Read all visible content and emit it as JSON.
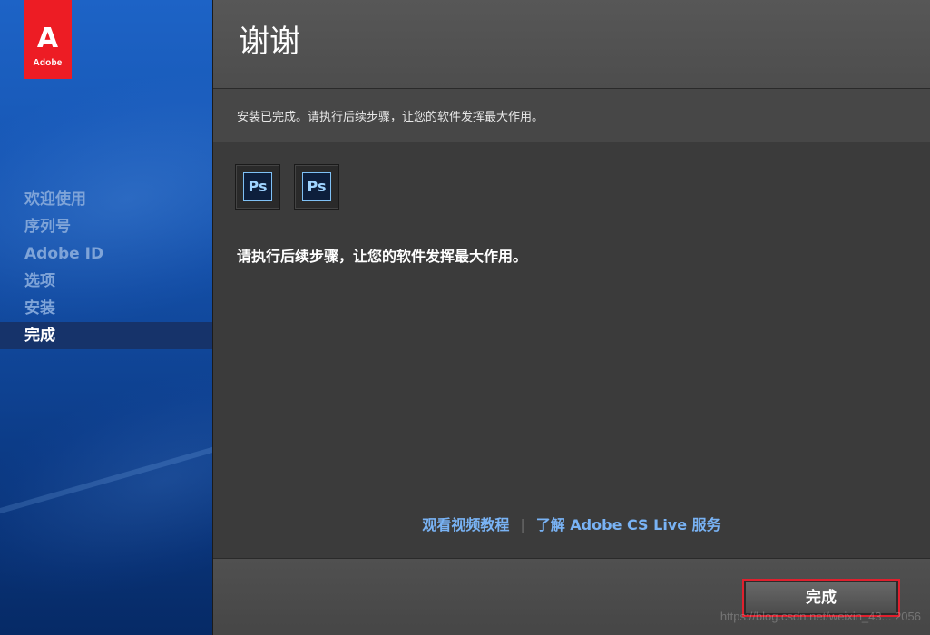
{
  "logo": {
    "letter": "A",
    "text": "Adobe"
  },
  "sidebar": {
    "steps": [
      {
        "label": "欢迎使用"
      },
      {
        "label": "序列号"
      },
      {
        "label": "Adobe ID"
      },
      {
        "label": "选项"
      },
      {
        "label": "安装"
      },
      {
        "label": "完成",
        "active": true
      }
    ]
  },
  "header": {
    "title": "谢谢"
  },
  "subheader": {
    "message": "安装已完成。请执行后续步骤，让您的软件发挥最大作用。"
  },
  "content": {
    "app_icons": [
      {
        "icon": "photoshop-icon",
        "label": "Ps"
      },
      {
        "icon": "photoshop-icon",
        "label": "Ps"
      }
    ],
    "body_text": "请执行后续步骤，让您的软件发挥最大作用。",
    "links": {
      "video": "观看视频教程",
      "separator": "|",
      "cs_live": "了解 Adobe CS Live 服务"
    }
  },
  "footer": {
    "finish_label": "完成",
    "watermark": "https://blog.csdn.net/weixin_43... 2056"
  },
  "colors": {
    "adobe_red": "#ed1c24",
    "sidebar_blue": "#1553ae",
    "link_blue": "#79b3f5",
    "highlight_red": "#e0202e"
  }
}
